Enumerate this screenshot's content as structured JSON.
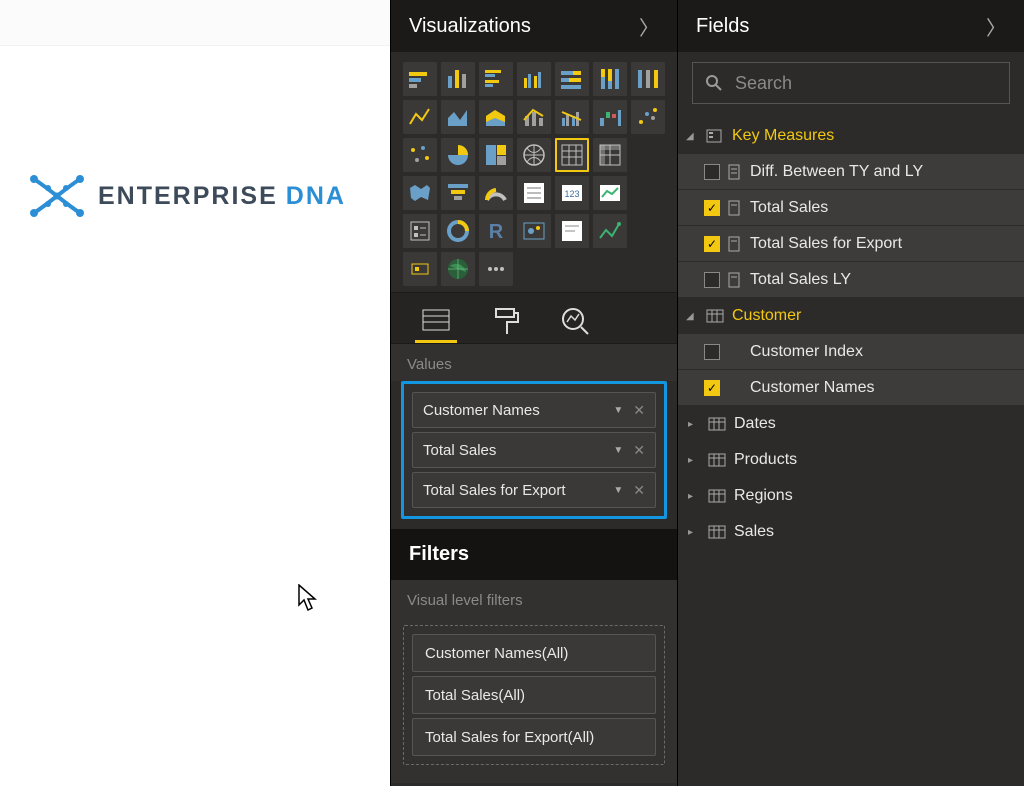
{
  "logo": {
    "word1": "ENTERPRISE",
    "word2": "DNA"
  },
  "viz": {
    "title": "Visualizations",
    "tabs": {
      "fields": "Fields",
      "format": "Format",
      "analytics": "Analytics"
    },
    "values_label": "Values",
    "values": [
      {
        "label": "Customer Names"
      },
      {
        "label": "Total Sales"
      },
      {
        "label": "Total Sales for Export"
      }
    ],
    "filters_title": "Filters",
    "visual_level_filters_label": "Visual level filters",
    "filters": [
      {
        "label": "Customer Names(All)"
      },
      {
        "label": "Total Sales(All)"
      },
      {
        "label": "Total Sales for Export(All)"
      }
    ]
  },
  "fields": {
    "title": "Fields",
    "search_placeholder": "Search",
    "groups": [
      {
        "name": "Key Measures",
        "expanded": true,
        "items": [
          {
            "label": "Diff. Between TY and LY",
            "checked": false
          },
          {
            "label": "Total Sales",
            "checked": true
          },
          {
            "label": "Total Sales for Export",
            "checked": true
          },
          {
            "label": "Total Sales LY",
            "checked": false
          }
        ]
      },
      {
        "name": "Customer",
        "expanded": true,
        "items": [
          {
            "label": "Customer Index",
            "checked": false
          },
          {
            "label": "Customer Names",
            "checked": true
          }
        ]
      }
    ],
    "tables": [
      {
        "name": "Dates"
      },
      {
        "name": "Products"
      },
      {
        "name": "Regions"
      },
      {
        "name": "Sales"
      }
    ]
  }
}
